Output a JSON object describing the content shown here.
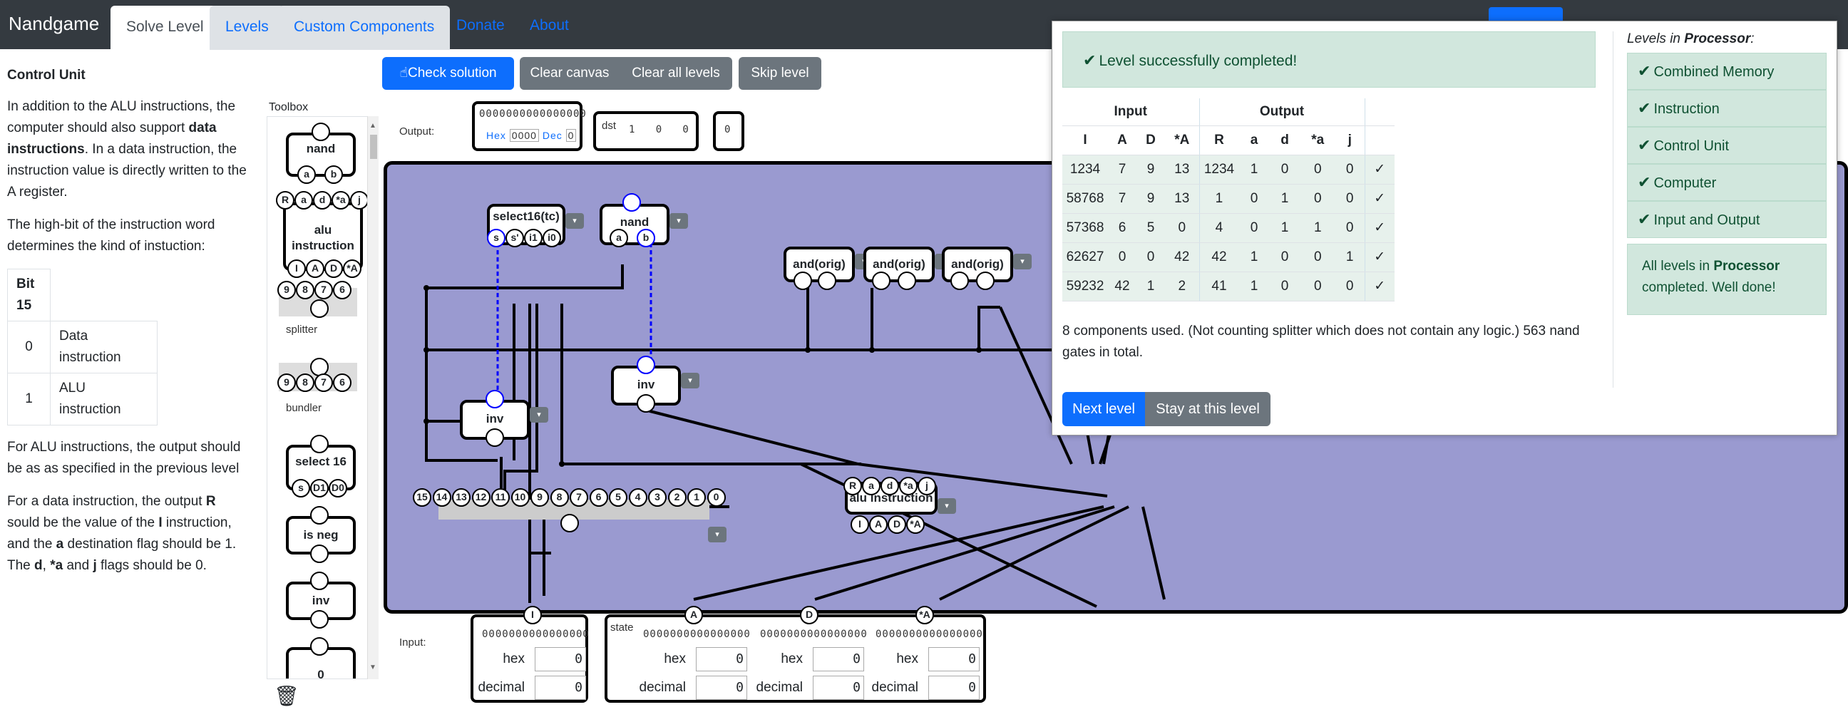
{
  "nav": {
    "brand": "Nandgame",
    "tabs": [
      "Solve Level",
      "Levels",
      "Custom Components"
    ],
    "links": [
      "Donate",
      "About"
    ]
  },
  "level": {
    "title": "Control Unit",
    "p1_a": "In addition to the ALU instructions, the computer should also support ",
    "p1_b": "data instructions",
    "p1_c": ". In a data instruction, the instruction value is directly written to the A register.",
    "p2": "The high-bit of the instruction word determines the kind of instuction:",
    "bit_header": "Bit 15",
    "bit_rows": [
      {
        "bit": "0",
        "meaning": "Data instruction"
      },
      {
        "bit": "1",
        "meaning": "ALU instruction"
      }
    ],
    "p3": "For ALU instructions, the output should be as as specified in the previous level",
    "p4_a": "For a data instruction, the output ",
    "p4_b": "R",
    "p4_c": " sould be the value of the ",
    "p4_d": "I",
    "p4_e": " instruction, and the ",
    "p4_f": "a",
    "p4_g": " destination flag should be 1. The ",
    "p4_h": "d",
    "p4_i": ", ",
    "p4_j": "*a",
    "p4_k": " and ",
    "p4_l": "j",
    "p4_m": " flags should be 0."
  },
  "toolbox": {
    "title": "Toolbox",
    "items": [
      "nand",
      "alu instruction",
      "splitter",
      "bundler",
      "select 16",
      "is neg",
      "inv",
      "0"
    ]
  },
  "toolbar": {
    "check": "Check solution",
    "clear_canvas": "Clear canvas",
    "clear_all": "Clear all levels",
    "skip": "Skip level"
  },
  "canvas": {
    "output_label": "Output:",
    "input_label": "Input:",
    "dst_label": "dst",
    "state_label": "state",
    "zero16": "0000000000000000",
    "hex_label": "Hex",
    "hex_val": "0000",
    "dec_label": "Dec",
    "dec_val": "0",
    "components": [
      "select16(tc)",
      "nand",
      "and(orig)",
      "and(orig)",
      "and(orig)",
      "inv",
      "inv",
      "alu instruction"
    ],
    "inputs": [
      {
        "name": "I",
        "hex": "0",
        "decimal": "0"
      },
      {
        "name": "A",
        "hex": "0",
        "decimal": "0"
      },
      {
        "name": "D",
        "hex": "0",
        "decimal": "0"
      },
      {
        "name": "*A",
        "hex": "0",
        "decimal": "0"
      }
    ],
    "field_hex": "hex",
    "field_decimal": "decimal"
  },
  "modal": {
    "success": "Level successfully completed!",
    "group_input": "Input",
    "group_output": "Output",
    "columns": [
      "I",
      "A",
      "D",
      "*A",
      "R",
      "a",
      "d",
      "*a",
      "j"
    ],
    "rows": [
      [
        "1234",
        "7",
        "9",
        "13",
        "1234",
        "1",
        "0",
        "0",
        "0",
        "✓"
      ],
      [
        "58768",
        "7",
        "9",
        "13",
        "1",
        "0",
        "1",
        "0",
        "0",
        "✓"
      ],
      [
        "57368",
        "6",
        "5",
        "0",
        "4",
        "0",
        "1",
        "1",
        "0",
        "✓"
      ],
      [
        "62627",
        "0",
        "0",
        "42",
        "42",
        "1",
        "0",
        "0",
        "1",
        "✓"
      ],
      [
        "59232",
        "42",
        "1",
        "2",
        "41",
        "1",
        "0",
        "0",
        "0",
        "✓"
      ]
    ],
    "summary": "8 components used. (Not counting splitter which does not contain any logic.) 563 nand gates in total.",
    "next": "Next level",
    "stay": "Stay at this level",
    "levels_head_a": "Levels in ",
    "levels_head_b": "Processor",
    "levels": [
      "Combined Memory",
      "Instruction",
      "Control Unit",
      "Computer",
      "Input and Output"
    ],
    "done_a": "All levels in ",
    "done_b": "Processor",
    "done_c": " completed. Well done!"
  }
}
